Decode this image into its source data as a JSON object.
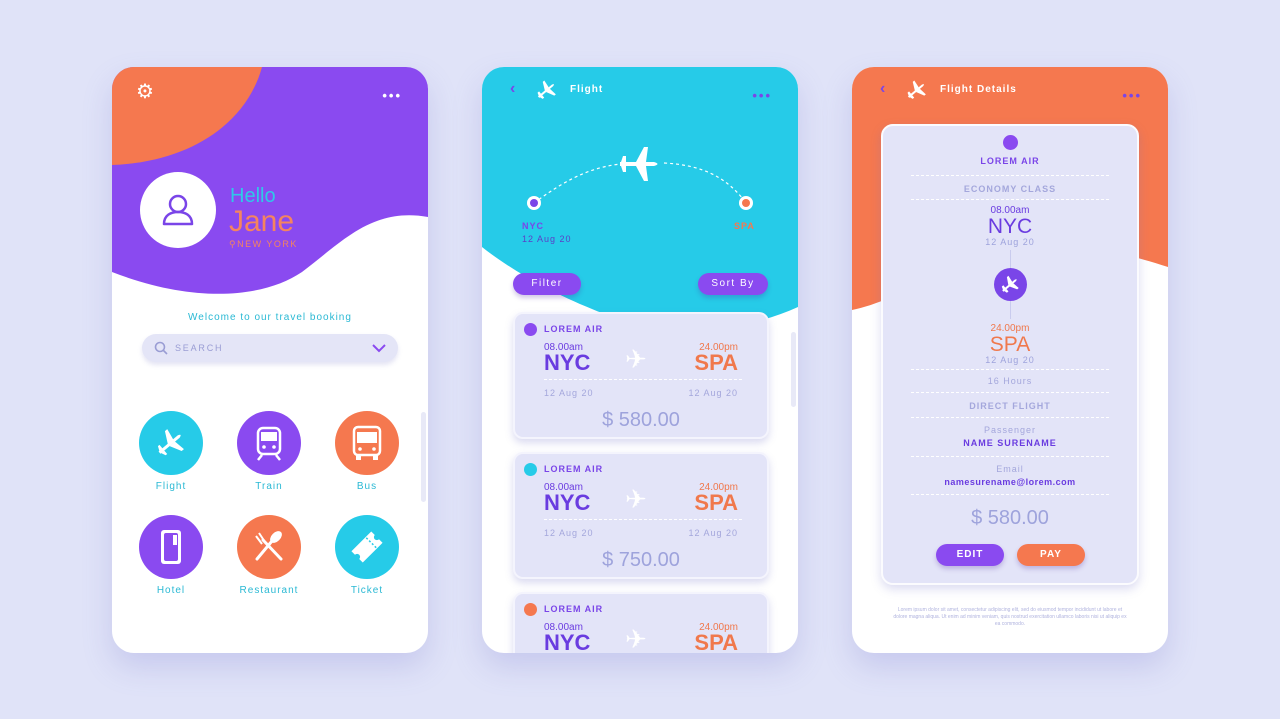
{
  "colors": {
    "purple": "#8a4af0",
    "orange": "#f5784f",
    "cyan": "#26cbe8",
    "background": "#e0e3f8"
  },
  "home": {
    "menu_icon": "more-horizontal-icon",
    "greeting": "Hello",
    "user_name": "Jane",
    "location": "NEW YORK",
    "welcome": "Welcome to our travel booking",
    "search_placeholder": "SEARCH",
    "categories": [
      {
        "label": "Flight",
        "icon": "plane-icon",
        "color": "#26cbe8"
      },
      {
        "label": "Train",
        "icon": "train-icon",
        "color": "#8a4af0"
      },
      {
        "label": "Bus",
        "icon": "bus-icon",
        "color": "#f5784f"
      },
      {
        "label": "Hotel",
        "icon": "hotel-key-icon",
        "color": "#8a4af0"
      },
      {
        "label": "Restaurant",
        "icon": "cutlery-icon",
        "color": "#f5784f"
      },
      {
        "label": "Ticket",
        "icon": "ticket-icon",
        "color": "#26cbe8"
      }
    ]
  },
  "flight": {
    "title": "Flight",
    "origin": "NYC",
    "origin_date": "12 Aug 20",
    "destination": "SPA",
    "filter_label": "Filter",
    "sort_label": "Sort By",
    "results": [
      {
        "airline": "LOREM AIR",
        "dot_color": "#8a4af0",
        "dep_time": "08.00am",
        "from": "NYC",
        "arr_time": "24.00pm",
        "to": "SPA",
        "dep_date": "12 Aug 20",
        "arr_date": "12 Aug 20",
        "price": "$ 580.00"
      },
      {
        "airline": "LOREM AIR",
        "dot_color": "#26cbe8",
        "dep_time": "08.00am",
        "from": "NYC",
        "arr_time": "24.00pm",
        "to": "SPA",
        "dep_date": "12 Aug 20",
        "arr_date": "12 Aug 20",
        "price": "$ 750.00"
      },
      {
        "airline": "LOREM AIR",
        "dot_color": "#f5784f",
        "dep_time": "08.00am",
        "from": "NYC",
        "arr_time": "24.00pm",
        "to": "SPA"
      }
    ]
  },
  "details": {
    "title": "Flight Details",
    "airline": "LOREM AIR",
    "class": "ECONOMY CLASS",
    "dep_time": "08.00am",
    "from": "NYC",
    "dep_date": "12 Aug 20",
    "arr_time": "24.00pm",
    "to": "SPA",
    "arr_date": "12 Aug 20",
    "duration": "16 Hours",
    "flight_type": "DIRECT FLIGHT",
    "passenger_label": "Passenger",
    "passenger": "NAME SURENAME",
    "email_label": "Email",
    "email": "namesurename@lorem.com",
    "price": "$ 580.00",
    "edit_label": "EDIT",
    "pay_label": "PAY",
    "fine_print": "Lorem ipsum dolor sit amet, consectetur adipiscing elit, sed do eiusmod tempor incididunt ut labore et dolore magna aliqua. Ut enim ad minim veniam, quis nostrud exercitation ullamco laboris nisi ut aliquip ex ea commodo."
  }
}
